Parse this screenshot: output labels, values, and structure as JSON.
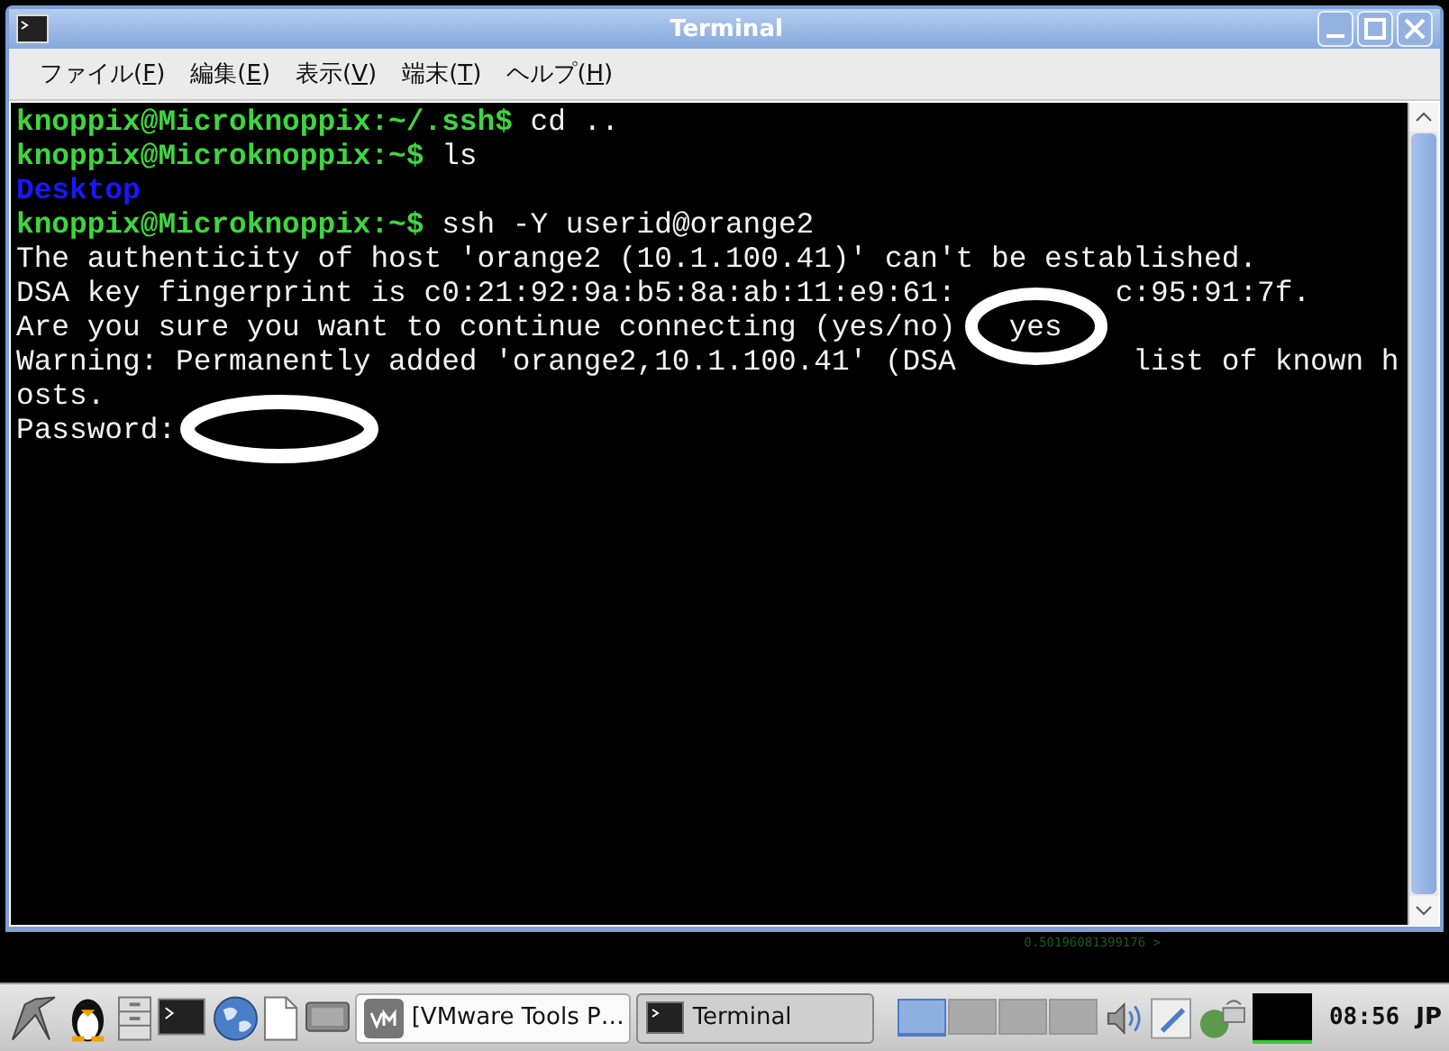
{
  "window": {
    "title": "Terminal"
  },
  "menu": [
    {
      "parts": [
        "ファイル(",
        "F",
        ")"
      ]
    },
    {
      "parts": [
        "編集(",
        "E",
        ")"
      ]
    },
    {
      "parts": [
        "表示(",
        "V",
        ")"
      ]
    },
    {
      "parts": [
        "端末(",
        "T",
        ")"
      ]
    },
    {
      "parts": [
        "ヘルプ(",
        "H",
        ")"
      ]
    }
  ],
  "terminal": {
    "lines": [
      {
        "segments": [
          {
            "kind": "prompt",
            "text": "knoppix@Microknoppix:~/.ssh$"
          },
          {
            "kind": "command",
            "text": " cd .."
          }
        ]
      },
      {
        "segments": [
          {
            "kind": "prompt",
            "text": "knoppix@Microknoppix:~$"
          },
          {
            "kind": "command",
            "text": " ls"
          }
        ]
      },
      {
        "segments": [
          {
            "kind": "directory",
            "text": "Desktop"
          }
        ]
      },
      {
        "segments": [
          {
            "kind": "prompt",
            "text": "knoppix@Microknoppix:~$"
          },
          {
            "kind": "command",
            "text": " ssh -Y userid@orange2"
          }
        ]
      },
      {
        "segments": [
          {
            "kind": "output",
            "text": "The authenticity of host 'orange2 (10.1.100.41)' can't be established."
          }
        ]
      },
      {
        "segments": [
          {
            "kind": "output",
            "text": "DSA key fingerprint is c0:21:92:9a:b5:8a:ab:11:e9:61:"
          },
          {
            "kind": "output",
            "text": "         c:95:91:7f."
          }
        ]
      },
      {
        "segments": [
          {
            "kind": "output",
            "text": "Are you sure you want to continue connecting (yes/no)"
          },
          {
            "kind": "output",
            "text": "   yes"
          }
        ]
      },
      {
        "segments": [
          {
            "kind": "output",
            "text": "Warning: Permanently added 'orange2,10.1.100.41' (DSA"
          },
          {
            "kind": "output",
            "text": "          list of known h"
          }
        ]
      },
      {
        "segments": [
          {
            "kind": "output",
            "text": "osts."
          }
        ]
      },
      {
        "segments": [
          {
            "kind": "output",
            "text": "Password:"
          }
        ]
      }
    ]
  },
  "desktop": {
    "text": "0.50196081399176 >"
  },
  "taskbar": {
    "tasks": [
      {
        "kind": "vm",
        "label": "[VMware Tools P…",
        "selected": false
      },
      {
        "kind": "terminal",
        "label": "Terminal",
        "selected": true
      }
    ],
    "workspaces": [
      {
        "selected": true
      },
      {
        "selected": false
      },
      {
        "selected": false
      },
      {
        "selected": false
      }
    ],
    "clock": "08:56",
    "language": "JP"
  }
}
